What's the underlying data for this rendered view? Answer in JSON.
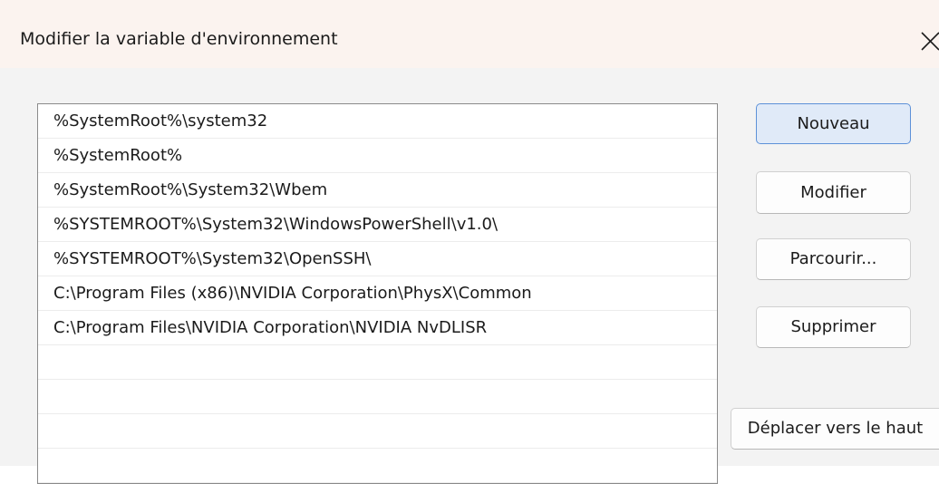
{
  "window": {
    "title": "Modifier la variable d'environnement"
  },
  "path_list": {
    "items": [
      "%SystemRoot%\\system32",
      "%SystemRoot%",
      "%SystemRoot%\\System32\\Wbem",
      "%SYSTEMROOT%\\System32\\WindowsPowerShell\\v1.0\\",
      "%SYSTEMROOT%\\System32\\OpenSSH\\",
      "C:\\Program Files (x86)\\NVIDIA Corporation\\PhysX\\Common",
      "C:\\Program Files\\NVIDIA Corporation\\NVIDIA NvDLISR",
      "",
      "",
      "",
      ""
    ]
  },
  "buttons": {
    "new": "Nouveau",
    "edit": "Modifier",
    "browse": "Parcourir...",
    "delete": "Supprimer",
    "move_up": "Déplacer vers le haut"
  },
  "icons": {
    "close": "close-icon"
  },
  "colors": {
    "title_bar": "#fbf3ef",
    "dialog_background": "#f3f3f3",
    "primary_button_fill": "#e0eaf8",
    "primary_button_border": "#5d91d8"
  }
}
